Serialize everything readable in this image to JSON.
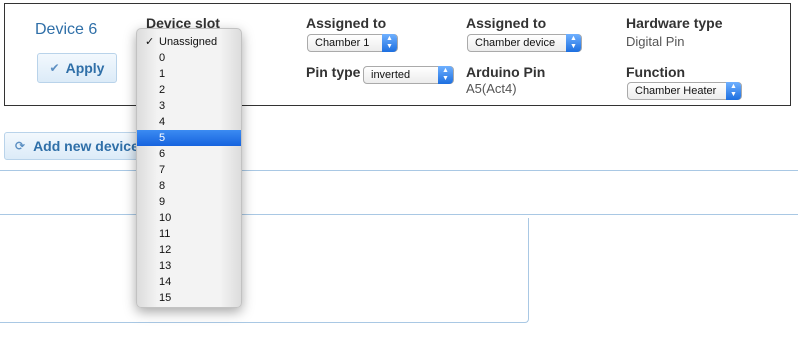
{
  "device": {
    "name": "Device 6",
    "apply_label": "Apply"
  },
  "fields": {
    "device_slot_label": "Device slot",
    "assigned_to_1_label": "Assigned to",
    "assigned_to_1_value": "Chamber 1",
    "assigned_to_2_label": "Assigned to",
    "assigned_to_2_value": "Chamber device",
    "hardware_type_label": "Hardware type",
    "hardware_type_value": "Digital Pin",
    "pin_type_label": "Pin type",
    "pin_type_value": "inverted",
    "arduino_pin_label": "Arduino Pin",
    "arduino_pin_value": "A5(Act4)",
    "function_label": "Function",
    "function_value": "Chamber Heater"
  },
  "add_device_label": "Add new device",
  "slot_menu": {
    "checked_index": 0,
    "highlighted_index": 6,
    "options": [
      "Unassigned",
      "0",
      "1",
      "2",
      "3",
      "4",
      "5",
      "6",
      "7",
      "8",
      "9",
      "10",
      "11",
      "12",
      "13",
      "14",
      "15"
    ]
  },
  "colors": {
    "accent": "#2f6fa8",
    "highlight": "#1d6fe0"
  },
  "icons": {
    "apply": "check-icon",
    "add_device": "refresh-icon",
    "select_arrow": "updown-arrows-icon",
    "checked": "checkmark-icon"
  }
}
